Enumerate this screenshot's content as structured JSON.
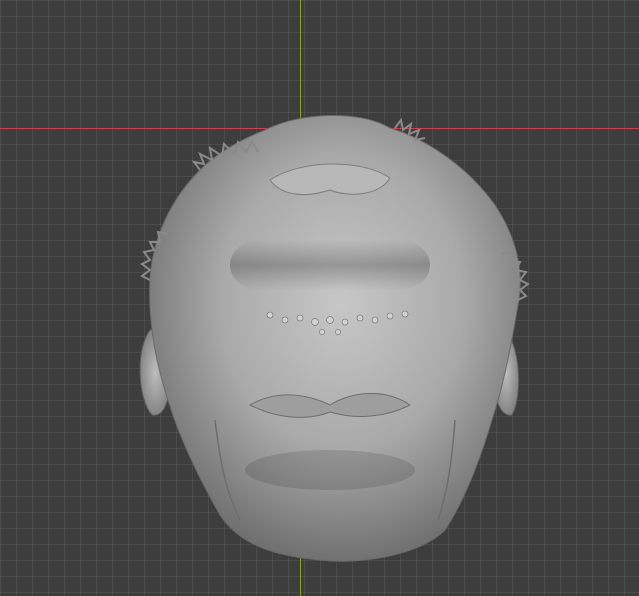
{
  "viewport": {
    "kind": "3d-viewport",
    "background_color": "#3d3d3d",
    "grid_color": "#4a4a4a",
    "axis_x_color": "#d7424f",
    "axis_y_color": "#8cb31a",
    "object": {
      "name_icon": "sculpted-head-mesh",
      "shading": "solid-gray",
      "color": "#a9a9a9"
    }
  }
}
